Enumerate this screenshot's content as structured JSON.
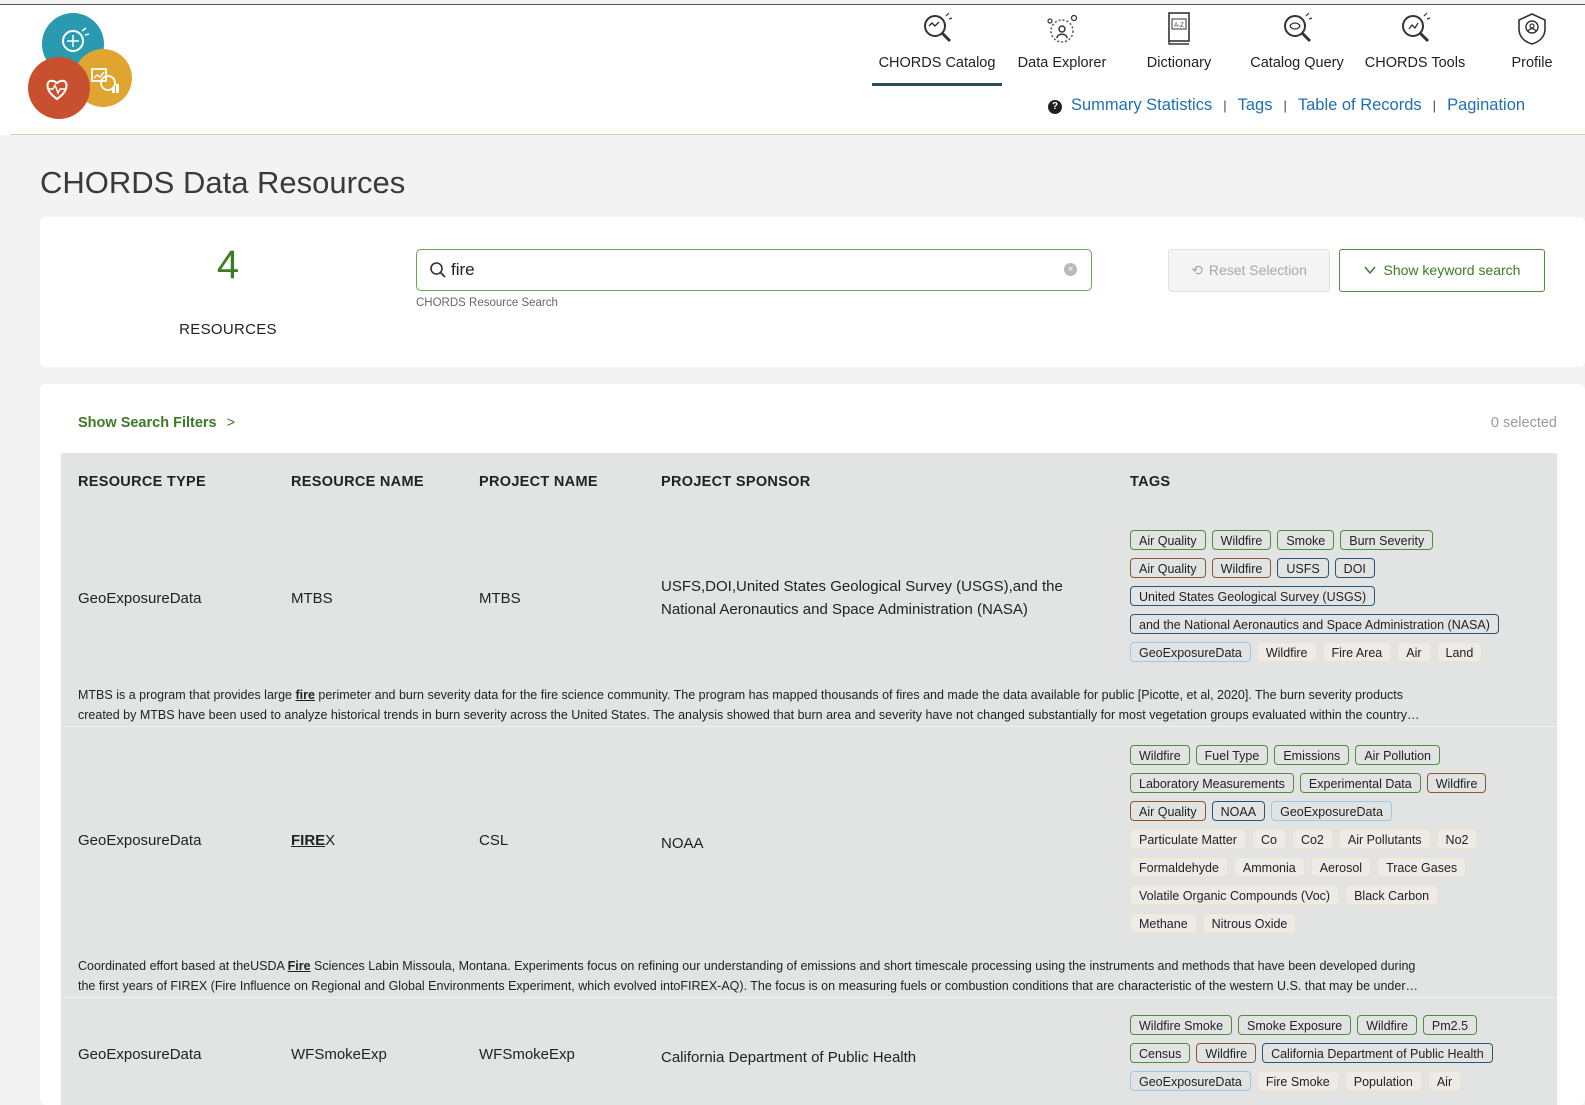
{
  "nav": {
    "items": [
      {
        "label": "CHORDS Catalog",
        "icon": "catalog-search-icon",
        "active": true
      },
      {
        "label": "Data Explorer",
        "icon": "data-explorer-icon",
        "active": false
      },
      {
        "label": "Dictionary",
        "icon": "dictionary-book-icon",
        "active": false
      },
      {
        "label": "Catalog Query",
        "icon": "catalog-query-icon",
        "active": false
      },
      {
        "label": "CHORDS Tools",
        "icon": "chords-tools-icon",
        "active": false
      },
      {
        "label": "Profile",
        "icon": "profile-badge-icon",
        "active": false
      }
    ],
    "sub_links": [
      "Summary Statistics",
      "Tags",
      "Table of Records",
      "Pagination"
    ]
  },
  "page": {
    "title": "CHORDS Data Resources"
  },
  "search": {
    "count": "4",
    "count_label": "RESOURCES",
    "query": "fire",
    "hint": "CHORDS Resource Search",
    "reset_label": "Reset Selection",
    "keyword_label": "Show keyword search"
  },
  "results": {
    "filters_label": "Show Search Filters",
    "selected": "0 selected",
    "columns": [
      "RESOURCE TYPE",
      "RESOURCE NAME",
      "PROJECT NAME",
      "PROJECT SPONSOR",
      "TAGS"
    ],
    "rows": [
      {
        "type": "GeoExposureData",
        "name_pre": "",
        "name_hl": "",
        "name_post": "MTBS",
        "project": "MTBS",
        "sponsor": "USFS,DOI,United States Geological Survey (USGS),and the National Aeronautics and Space Administration (NASA)",
        "desc1_pre": "MTBS is a program that provides large ",
        "desc1_hl": "fire",
        "desc1_post": " perimeter and burn severity data for the fire science community. The program has mapped thousands of fires and made the data available for public [Picotte, et al, 2020]. The burn severity products",
        "desc2": "created by MTBS have been used to analyze historical trends in burn severity across the United States. The analysis showed that burn area and severity have not changed substantially for most vegetation groups evaluated within the country…",
        "tag_rows": [
          [
            {
              "t": "Air Quality",
              "k": "g"
            },
            {
              "t": "Wildfire",
              "k": "g"
            },
            {
              "t": "Smoke",
              "k": "g"
            },
            {
              "t": "Burn Severity",
              "k": "g"
            }
          ],
          [
            {
              "t": "Air Quality",
              "k": "b"
            },
            {
              "t": "Wildfire",
              "k": "b"
            },
            {
              "t": "USFS",
              "k": "n"
            },
            {
              "t": "DOI",
              "k": "n"
            }
          ],
          [
            {
              "t": "United States Geological Survey (USGS)",
              "k": "n"
            }
          ],
          [
            {
              "t": "and the National Aeronautics and Space Administration (NASA)",
              "k": "n"
            }
          ],
          [
            {
              "t": "GeoExposureData",
              "k": "l"
            },
            {
              "t": "Wildfire",
              "k": "p"
            },
            {
              "t": "Fire Area",
              "k": "p"
            },
            {
              "t": "Air",
              "k": "p"
            },
            {
              "t": "Land",
              "k": "p"
            }
          ]
        ]
      },
      {
        "type": "GeoExposureData",
        "name_pre": "",
        "name_hl": "FIRE",
        "name_post": "X",
        "project": "CSL",
        "sponsor": "NOAA",
        "desc1_pre": "Coordinated effort based at theUSDA ",
        "desc1_hl": "Fire",
        "desc1_post": " Sciences Labin Missoula, Montana. Experiments focus on refining our understanding of emissions and short timescale processing using the instruments and methods that have been developed during",
        "desc2": "the first years of FIREX (Fire Influence on Regional and Global Environments Experiment, which evolved intoFIREX-AQ). The focus is on measuring fuels or combustion conditions that are characteristic of the western U.S. that may be under…",
        "tag_rows": [
          [
            {
              "t": "Wildfire",
              "k": "g"
            },
            {
              "t": "Fuel Type",
              "k": "g"
            },
            {
              "t": "Emissions",
              "k": "g"
            },
            {
              "t": "Air Pollution",
              "k": "g"
            }
          ],
          [
            {
              "t": "Laboratory Measurements",
              "k": "g"
            },
            {
              "t": "Experimental Data",
              "k": "g"
            },
            {
              "t": "Wildfire",
              "k": "b"
            }
          ],
          [
            {
              "t": "Air Quality",
              "k": "b"
            },
            {
              "t": "NOAA",
              "k": "n"
            },
            {
              "t": "GeoExposureData",
              "k": "l"
            }
          ],
          [
            {
              "t": "Particulate Matter",
              "k": "p"
            },
            {
              "t": "Co",
              "k": "p"
            },
            {
              "t": "Co2",
              "k": "p"
            },
            {
              "t": "Air Pollutants",
              "k": "p"
            },
            {
              "t": "No2",
              "k": "p"
            }
          ],
          [
            {
              "t": "Formaldehyde",
              "k": "p"
            },
            {
              "t": "Ammonia",
              "k": "p"
            },
            {
              "t": "Aerosol",
              "k": "p"
            },
            {
              "t": "Trace Gases",
              "k": "p"
            }
          ],
          [
            {
              "t": "Volatile Organic Compounds (Voc)",
              "k": "p"
            },
            {
              "t": "Black Carbon",
              "k": "p"
            }
          ],
          [
            {
              "t": "Methane",
              "k": "p"
            },
            {
              "t": "Nitrous Oxide",
              "k": "p"
            }
          ]
        ]
      },
      {
        "type": "GeoExposureData",
        "name_pre": "",
        "name_hl": "",
        "name_post": "WFSmokeExp",
        "project": "WFSmokeExp",
        "sponsor": "California Department of Public Health",
        "desc1_pre": "",
        "desc1_hl": "",
        "desc1_post": "",
        "desc2": "",
        "tag_rows": [
          [
            {
              "t": "Wildfire Smoke",
              "k": "g"
            },
            {
              "t": "Smoke Exposure",
              "k": "g"
            },
            {
              "t": "Wildfire",
              "k": "g"
            },
            {
              "t": "Pm2.5",
              "k": "g"
            }
          ],
          [
            {
              "t": "Census",
              "k": "g"
            },
            {
              "t": "Wildfire",
              "k": "b"
            },
            {
              "t": "California Department of Public Health",
              "k": "n"
            }
          ],
          [
            {
              "t": "GeoExposureData",
              "k": "l"
            },
            {
              "t": "Fire Smoke",
              "k": "p"
            },
            {
              "t": "Population",
              "k": "p"
            },
            {
              "t": "Air",
              "k": "p"
            }
          ]
        ]
      }
    ]
  }
}
